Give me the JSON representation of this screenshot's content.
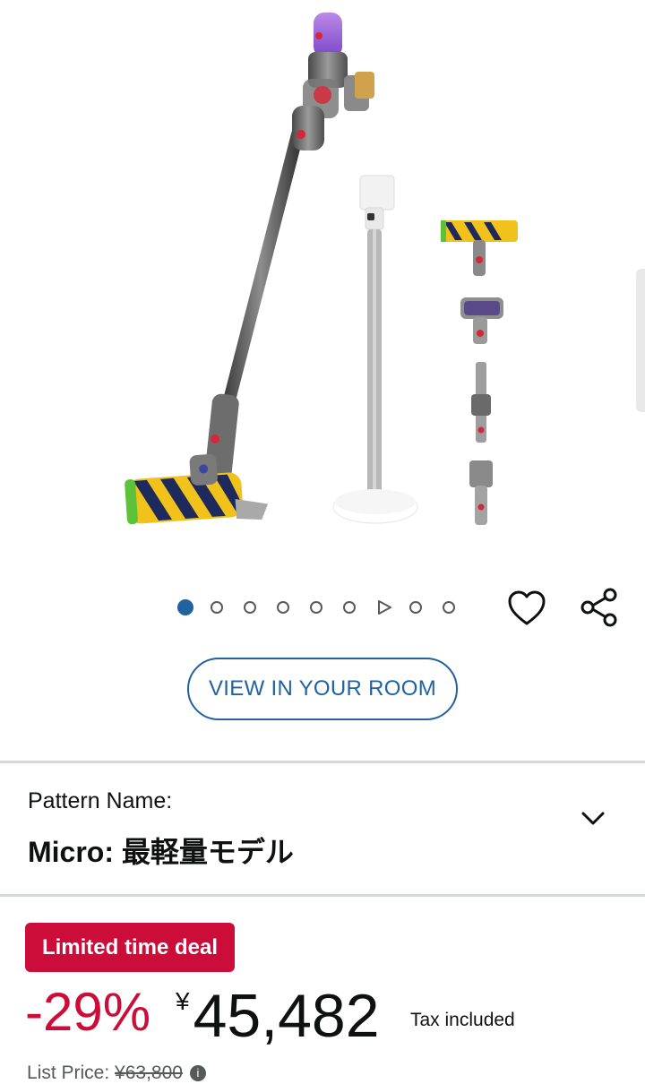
{
  "gallery": {
    "image_count": 9,
    "active_index": 0,
    "video_index": 6
  },
  "actions": {
    "wishlist_icon": "heart-outline",
    "share_icon": "share-nodes"
  },
  "view_in_room": {
    "label": "VIEW IN YOUR ROOM"
  },
  "pattern": {
    "label": "Pattern Name:",
    "value_prefix": "Micro: ",
    "value_jp": "最軽量モデル",
    "expand_icon": "chevron-down"
  },
  "deal": {
    "badge": "Limited time deal",
    "discount": "-29%",
    "currency": "¥",
    "price": "45,482",
    "tax_note": "Tax included",
    "list_price_label": "List Price: ",
    "list_price": "¥63,800"
  },
  "colors": {
    "accent_blue": "#2162a1",
    "deal_red": "#cc0c39",
    "text": "#0f1111",
    "muted": "#565959"
  }
}
